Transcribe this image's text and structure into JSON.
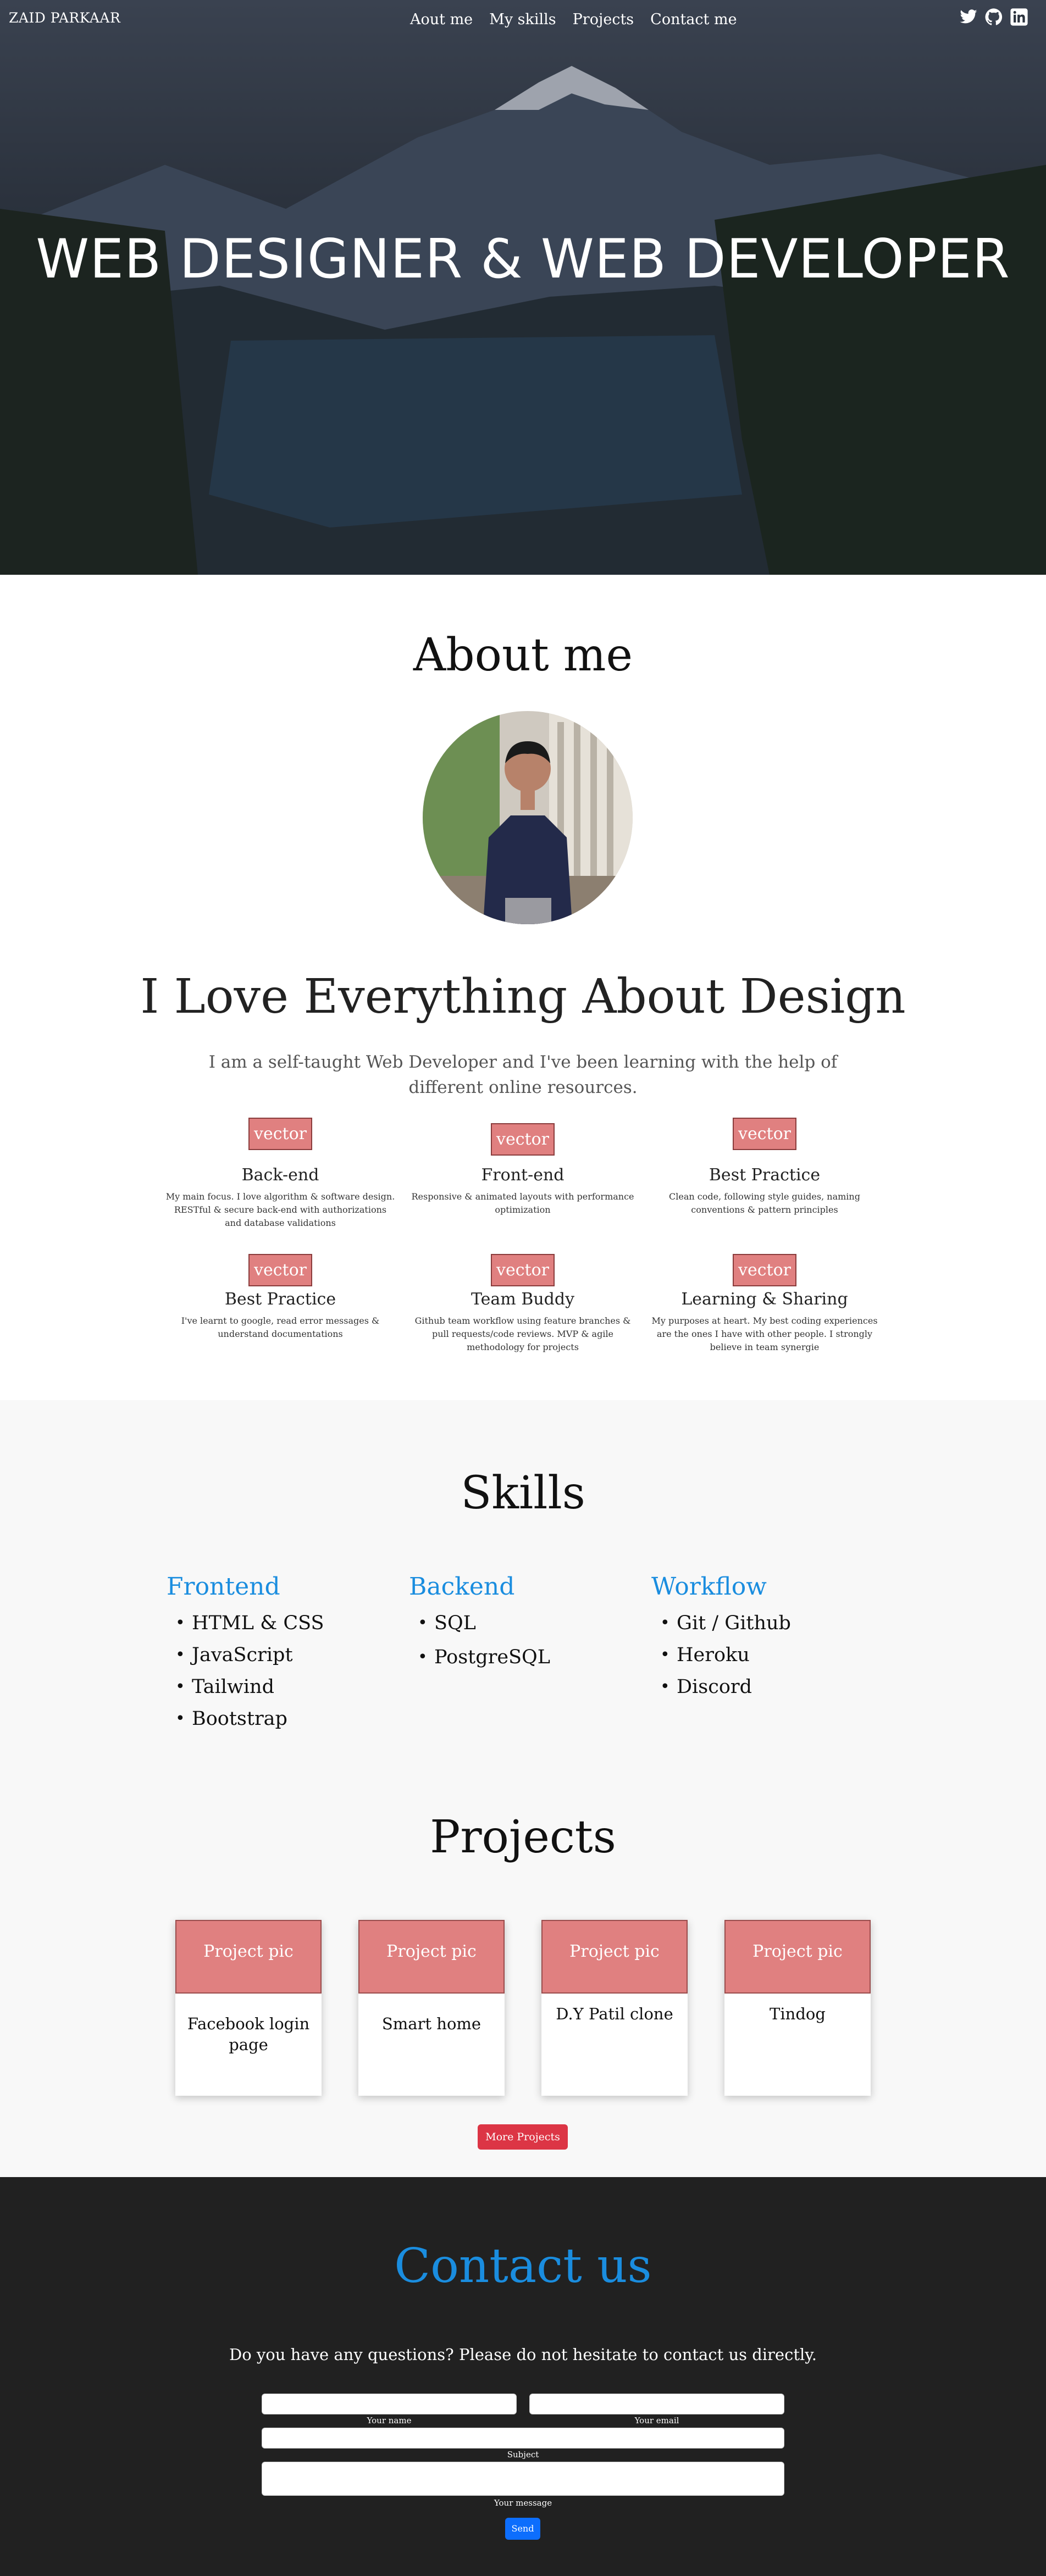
{
  "header": {
    "brand": "ZAID PARKAAR",
    "nav": [
      "Aout me",
      "My skills",
      "Projects",
      "Contact me"
    ],
    "social_icons": [
      "twitter-icon",
      "github-icon",
      "linkedin-icon"
    ]
  },
  "hero": {
    "title": "WEB DESIGNER & WEB DEVELOPER"
  },
  "about": {
    "title": "About me",
    "tagline": "I Love Everything About Design",
    "intro": "I am a self-taught Web Developer and I've been learning with the help of different online resources.",
    "features": [
      {
        "icon": "vector",
        "title": "Back-end",
        "text": "My main focus. I love algorithm & software design. RESTful & secure back-end with authorizations and database validations"
      },
      {
        "icon": "vector",
        "title": "Front-end",
        "text": "Responsive & animated layouts with performance optimization"
      },
      {
        "icon": "vector",
        "title": "Best Practice",
        "text": "Clean code, following style guides, naming conventions & pattern principles"
      },
      {
        "icon": "vector",
        "title": "Best Practice",
        "text": "I've learnt to google, read error messages & understand documentations"
      },
      {
        "icon": "vector",
        "title": "Team Buddy",
        "text": "Github team workflow using feature branches & pull requests/code reviews. MVP & agile methodology for projects"
      },
      {
        "icon": "vector",
        "title": "Learning & Sharing",
        "text": "My purposes at heart. My best coding experiences are the ones I have with other people. I strongly believe in team synergie"
      }
    ]
  },
  "skills": {
    "title": "Skills",
    "columns": [
      {
        "heading": "Frontend",
        "items": [
          "HTML & CSS",
          "JavaScript",
          "Tailwind",
          "Bootstrap"
        ]
      },
      {
        "heading": "Backend",
        "items": [
          "SQL",
          "PostgreSQL"
        ]
      },
      {
        "heading": "Workflow",
        "items": [
          "Git / Github",
          "Heroku",
          "Discord"
        ]
      }
    ]
  },
  "projects": {
    "title": "Projects",
    "cards": [
      {
        "pic": "Project pic",
        "name": "Facebook login page"
      },
      {
        "pic": "Project pic",
        "name": "Smart home"
      },
      {
        "pic": "Project pic",
        "name": "D.Y Patil clone"
      },
      {
        "pic": "Project pic",
        "name": "Tindog"
      }
    ],
    "more_label": "More Projects"
  },
  "contact": {
    "title": "Contact us",
    "question": "Do you have any questions? Please do not hesitate to contact us directly.",
    "labels": {
      "name": "Your name",
      "email": "Your email",
      "subject": "Subject",
      "message": "Your message"
    },
    "send_label": "Send"
  },
  "colors": {
    "accent_blue": "#1a8ddf",
    "placeholder_pink": "#e08080",
    "danger": "#dc3545",
    "primary": "#0d6efd",
    "footer_bg": "#212121"
  }
}
